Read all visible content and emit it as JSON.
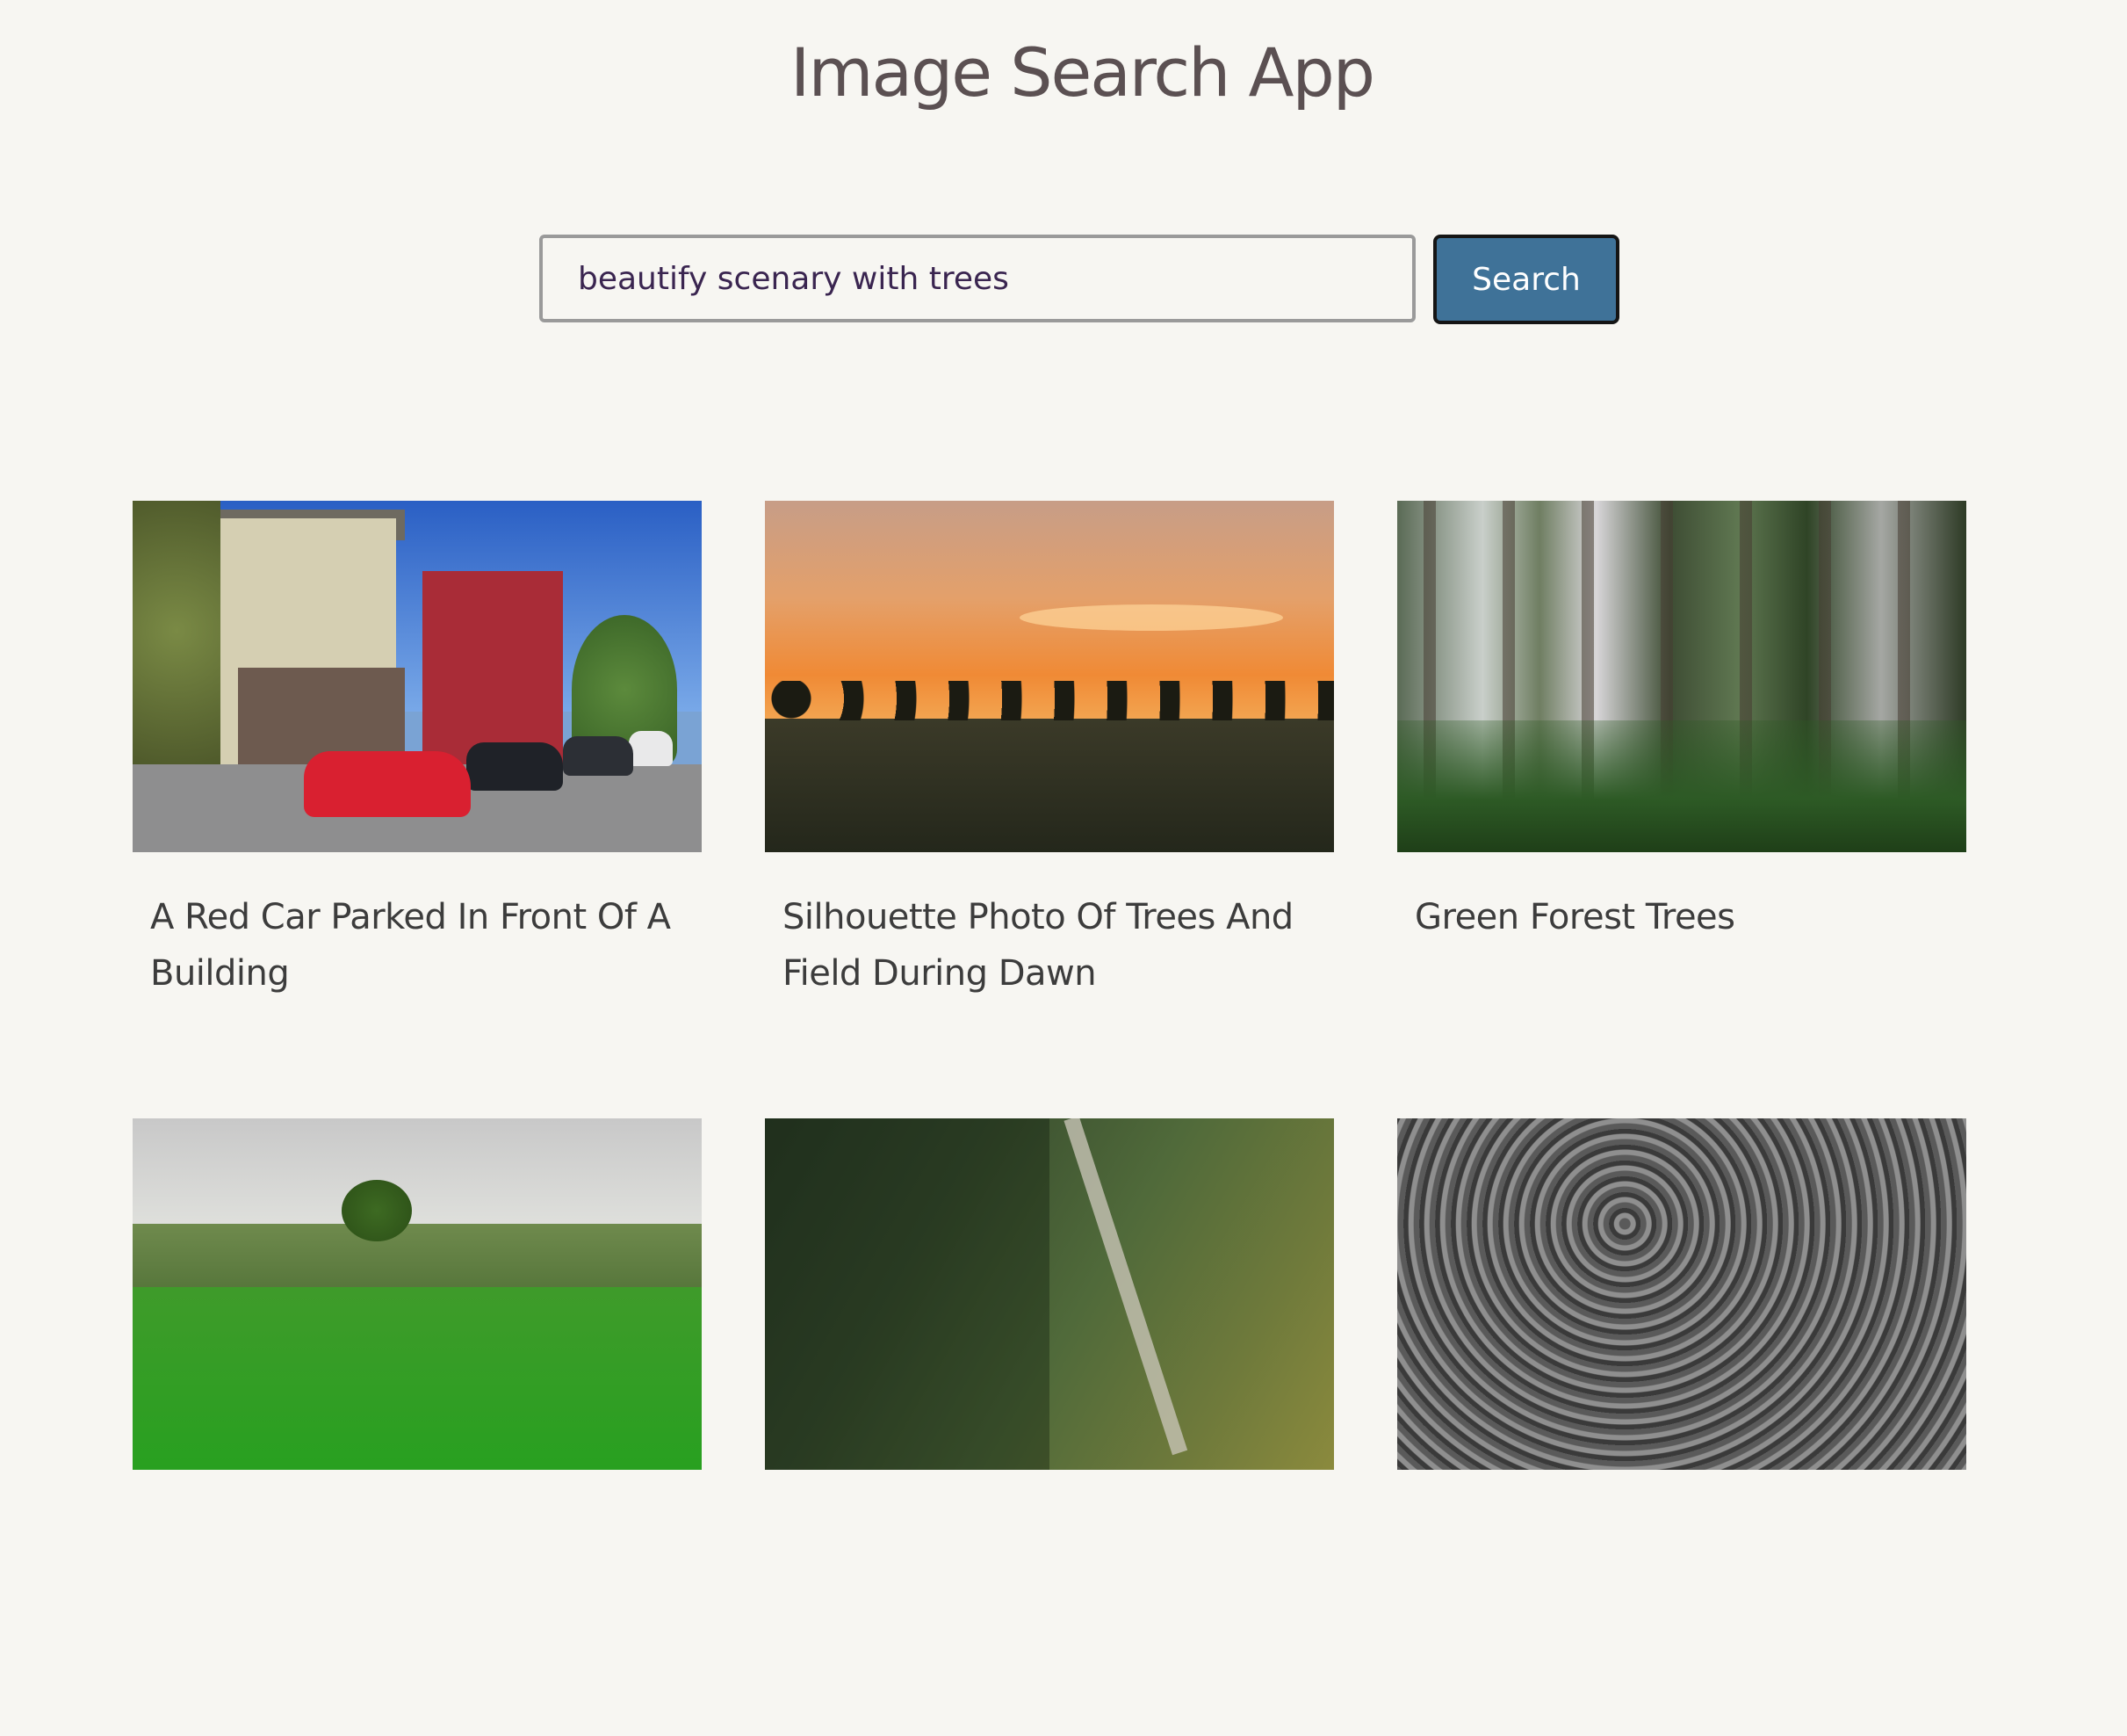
{
  "app": {
    "title": "Image Search App"
  },
  "search": {
    "value": "beautify scenary with trees",
    "button_label": "Search"
  },
  "results": [
    {
      "title": "A Red Car Parked In Front Of A Building",
      "image": "street-with-red-car-image"
    },
    {
      "title": "Silhouette Photo Of Trees And Field During Dawn",
      "image": "sunset-trees-field-image"
    },
    {
      "title": "Green Forest Trees",
      "image": "misty-forest-image"
    },
    {
      "title": "",
      "image": "green-meadow-tree-image"
    },
    {
      "title": "",
      "image": "forest-valley-aerial-image"
    },
    {
      "title": "",
      "image": "black-white-forest-aerial-image"
    }
  ],
  "colors": {
    "background": "#f7f6f2",
    "button": "#3f7298",
    "title_text": "#5b5052"
  }
}
